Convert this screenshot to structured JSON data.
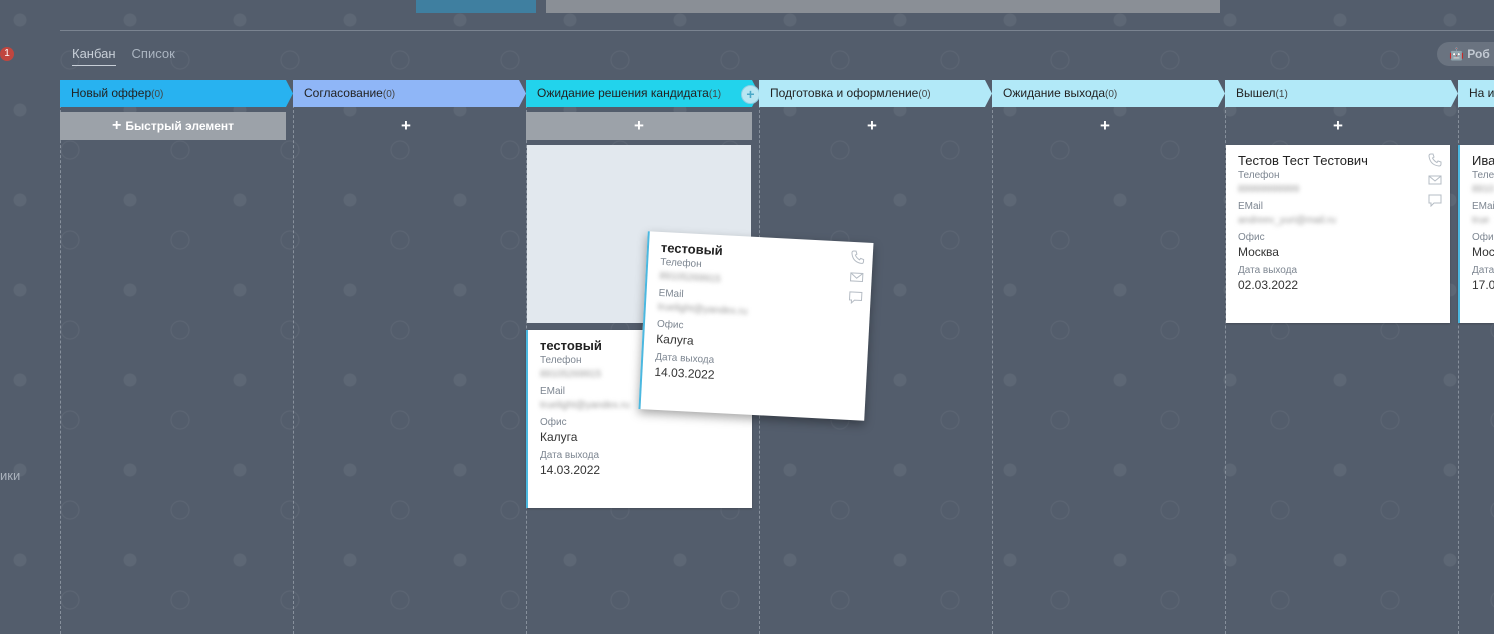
{
  "top": {
    "left_badge": "1",
    "left_edge_text": "ики",
    "robot_label": "Роб"
  },
  "view_tabs": [
    {
      "label": "Канбан",
      "active": true
    },
    {
      "label": "Список",
      "active": false
    }
  ],
  "columns": [
    {
      "title": "Новый оффер",
      "count": "(0)",
      "color": "#28b2f0",
      "add_label": "Быстрый элемент"
    },
    {
      "title": "Согласование",
      "count": "(0)",
      "color": "#8fb6f7"
    },
    {
      "title": "Ожидание решения кандидата",
      "count": "(1)",
      "color": "#22d3ec"
    },
    {
      "title": "Подготовка и оформление",
      "count": "(0)",
      "color": "#b2e9f8"
    },
    {
      "title": "Ожидание выхода",
      "count": "(0)",
      "color": "#b2e9f8"
    },
    {
      "title": "Вышел",
      "count": "(1)",
      "color": "#b2e9f8"
    },
    {
      "title": "На ис",
      "count": "",
      "color": "#b2e9f8"
    }
  ],
  "plus_symbol": "+",
  "labels": {
    "phone": "Телефон",
    "email": "EMail",
    "office": "Офис",
    "exit_date": "Дата выхода"
  },
  "cards": {
    "waiting": {
      "name": "тестовый",
      "phone": "89105269915",
      "email": "truelight@yandex.ru",
      "office": "Калуга",
      "exit_date": "14.03.2022"
    },
    "dragged": {
      "name": "тестовый",
      "phone": "89105269915",
      "email": "truelight@yandex.ru",
      "office": "Калуга",
      "exit_date": "14.03.2022"
    },
    "left": {
      "name": "Тестов Тест Тестович",
      "phone": "89999999999",
      "email": "andreev_yuri@mail.ru",
      "office": "Москва",
      "exit_date": "02.03.2022"
    },
    "partial": {
      "name": "Ива",
      "phone_lbl": "Теле",
      "phone": "8910",
      "email_lbl": "EMai",
      "email": "true",
      "office_lbl": "Офи",
      "office": "Мос",
      "exit_lbl": "Дата",
      "exit_date": "17.0"
    }
  }
}
